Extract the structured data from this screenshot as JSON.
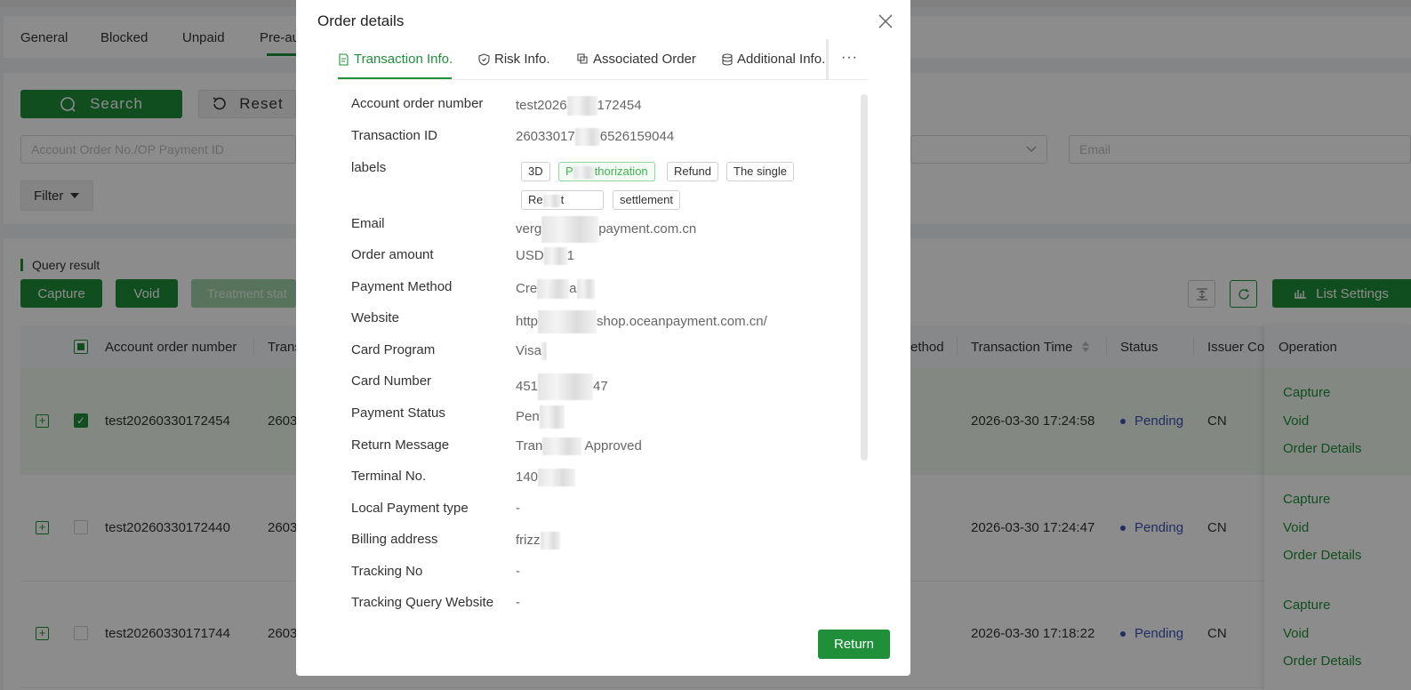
{
  "bg": {
    "tabs": [
      "General",
      "Blocked",
      "Unpaid",
      "Pre-au"
    ],
    "search_label": "Search",
    "reset_label": "Reset",
    "order_input_placeholder": "Account Order No./OP Payment ID",
    "email_placeholder": "Email",
    "filter_label": "Filter",
    "query_result": "Query result",
    "capture_label": "Capture",
    "void_label": "Void",
    "treatment_label": "Treatment stat",
    "list_settings": "List Settings",
    "columns": {
      "account_order": "Account order number",
      "trans": "Trans",
      "ethod": "ethod",
      "tx_time": "Transaction Time",
      "status": "Status",
      "issuer": "Issuer Cou",
      "operation": "Operation"
    },
    "rows": [
      {
        "order": "test20260330172454",
        "tx": "2603",
        "time": "2026-03-30 17:24:58",
        "status": "Pending",
        "country": "CN"
      },
      {
        "order": "test20260330172440",
        "tx": "2603",
        "time": "2026-03-30 17:24:47",
        "status": "Pending",
        "country": "CN"
      },
      {
        "order": "test20260330171744",
        "tx": "2603",
        "time": "2026-03-30 17:18:22",
        "status": "Pending",
        "country": "CN"
      }
    ],
    "ops": {
      "capture": "Capture",
      "void": "Void",
      "details": "Order Details"
    }
  },
  "modal": {
    "title": "Order details",
    "tabs": [
      "Transaction Info.",
      "Risk Info.",
      "Associated Order",
      "Additional Info."
    ],
    "more": "···",
    "fields": [
      {
        "label": "Account order number",
        "value_pre": "test2026",
        "value_post": "172454"
      },
      {
        "label": "Transaction ID",
        "value_pre": "26033017",
        "value_post": "6526159044"
      },
      {
        "label": "labels"
      },
      {
        "label": "Email",
        "value_pre": "verg",
        "value_post": "payment.com.cn"
      },
      {
        "label": "Order amount",
        "value_pre": "USD",
        "value_post": "1"
      },
      {
        "label": "Payment Method",
        "value_pre": "Cre",
        "value_post": "a"
      },
      {
        "label": "Website",
        "value_pre": "http",
        "value_post": "shop.oceanpayment.com.cn/"
      },
      {
        "label": "Card Program",
        "value_pre": "Visa",
        "value_post": ""
      },
      {
        "label": "Card Number",
        "value_pre": "451",
        "value_post": "47"
      },
      {
        "label": "Payment Status",
        "value_pre": "Pen",
        "value_post": ""
      },
      {
        "label": "Return Message",
        "value_pre": "Tran",
        "value_post": "Approved"
      },
      {
        "label": "Terminal No.",
        "value_pre": "140",
        "value_post": ""
      },
      {
        "label": "Local Payment type",
        "value_pre": "-",
        "value_post": ""
      },
      {
        "label": "Billing address",
        "value_pre": "frizz",
        "value_post": ""
      },
      {
        "label": "Tracking No",
        "value_pre": "-",
        "value_post": ""
      },
      {
        "label": "Tracking Query Website",
        "value_pre": "-",
        "value_post": ""
      }
    ],
    "tags": [
      "3D",
      "P",
      "thorization",
      "Refund",
      "The single",
      "Re",
      "t",
      "settlement"
    ],
    "return_label": "Return"
  },
  "colors": {
    "primary": "#1f8f3a",
    "pending": "#3f51b5"
  }
}
